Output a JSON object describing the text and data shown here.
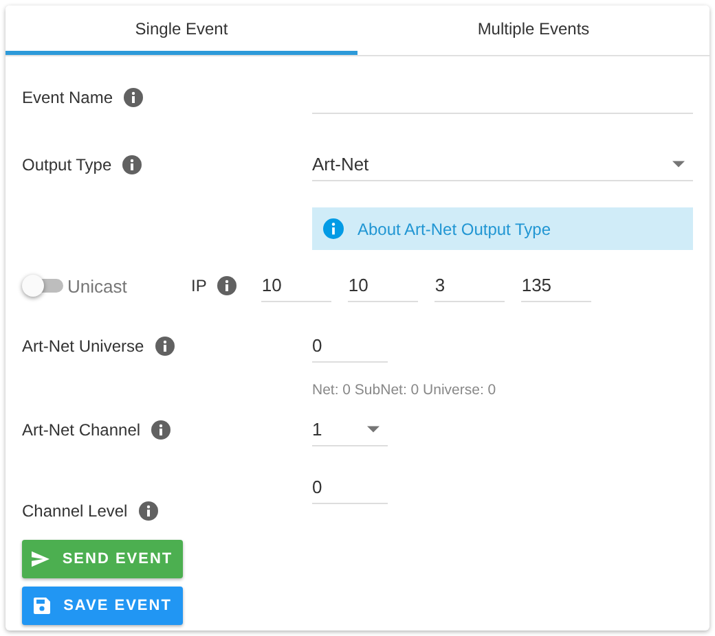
{
  "tabs": [
    {
      "label": "Single Event",
      "selected": true
    },
    {
      "label": "Multiple Events",
      "selected": false
    }
  ],
  "event_name": {
    "label": "Event Name"
  },
  "output_type": {
    "label": "Output Type",
    "value": "Art-Net"
  },
  "info_alert": {
    "text": "About Art-Net Output Type"
  },
  "unicast": {
    "label": "Unicast",
    "on": false
  },
  "ip": {
    "label": "IP",
    "octets": [
      "10",
      "10",
      "3",
      "135"
    ]
  },
  "universe": {
    "label": "Art-Net Universe",
    "value": "0",
    "hint": "Net: 0 SubNet: 0 Universe: 0"
  },
  "channel": {
    "label": "Art-Net Channel",
    "value": "1"
  },
  "channel_level": {
    "label": "Channel Level",
    "value": "0"
  },
  "buttons": [
    {
      "label": "SEND EVENT",
      "kind": "send"
    },
    {
      "label": "SAVE EVENT",
      "kind": "save"
    }
  ]
}
